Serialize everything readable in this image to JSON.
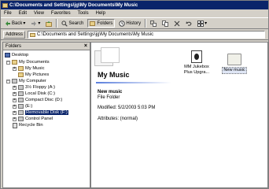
{
  "window": {
    "title": "C:\\Documents and Settings\\jg\\My Documents\\My Music"
  },
  "menubar": {
    "items": [
      "File",
      "Edit",
      "View",
      "Favorites",
      "Tools",
      "Help"
    ]
  },
  "toolbar": {
    "back_label": "Back",
    "forward_label": "",
    "search_label": "Search",
    "folders_label": "Folders",
    "history_label": "History"
  },
  "address": {
    "label": "Address",
    "value": "C:\\Documents and Settings\\jg\\My Documents\\My Music"
  },
  "folders_pane": {
    "title": "Folders",
    "close_glyph": "×",
    "tree": [
      {
        "label": "Desktop",
        "icon": "desktop-icon",
        "pm": ""
      },
      {
        "label": "My Documents",
        "icon": "folder-icon",
        "pm": "−"
      },
      {
        "label": "My Music",
        "icon": "folder-icon",
        "pm": "+"
      },
      {
        "label": "My Pictures",
        "icon": "folder-icon",
        "pm": ""
      },
      {
        "label": "My Computer",
        "icon": "computer-icon",
        "pm": "−"
      },
      {
        "label": "3½ Floppy (A:)",
        "icon": "floppy-icon",
        "pm": "+"
      },
      {
        "label": "Local Disk (C:)",
        "icon": "disk-icon",
        "pm": "+"
      },
      {
        "label": "Compact Disc (D:)",
        "icon": "cd-icon",
        "pm": "+"
      },
      {
        "label": "(E:)",
        "icon": "disk-icon",
        "pm": "+"
      },
      {
        "label": "Removable Disk (F:)",
        "icon": "removable-disk-icon",
        "pm": "+"
      },
      {
        "label": "Control Panel",
        "icon": "control-panel-icon",
        "pm": "+"
      },
      {
        "label": "Recycle Bin",
        "icon": "recycle-bin-icon",
        "pm": ""
      }
    ]
  },
  "content": {
    "folder_title": "My Music",
    "selected_name": "New music",
    "selected_type": "File Folder",
    "modified": "Modified: 5/2/2003 5:03 PM",
    "attributes": "Attributes: (normal)",
    "items": [
      {
        "label": "MM Jukebox Plus Upgra...",
        "icon": "jukebox-icon"
      },
      {
        "label": "New music",
        "icon": "folder-icon"
      }
    ]
  },
  "colors": {
    "titlebar": "#0a246a",
    "selection": "#0a246a",
    "chrome": "#d4d0c8"
  }
}
